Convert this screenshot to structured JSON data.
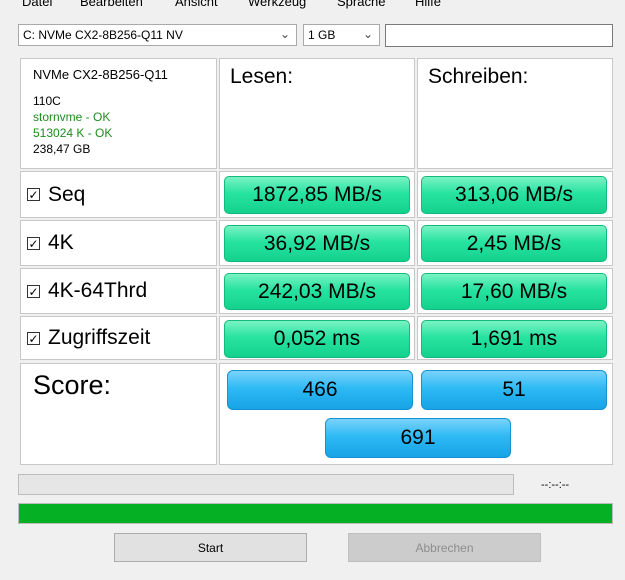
{
  "menu": [
    "Datei",
    "Bearbeiten",
    "Ansicht",
    "Werkzeug",
    "Sprache",
    "Hilfe"
  ],
  "drive_select": {
    "value": "C: NVMe CX2-8B256-Q11 NV"
  },
  "size_select": {
    "value": "1 GB"
  },
  "info": {
    "model": "NVMe CX2-8B256-Q11",
    "firmware": "110C",
    "driver": "stornvme - OK",
    "alignment": "513024 K - OK",
    "capacity": "238,47 GB"
  },
  "columns": {
    "read": "Lesen:",
    "write": "Schreiben:"
  },
  "rows": [
    {
      "label": "Seq",
      "read": "1872,85 MB/s",
      "write": "313,06 MB/s",
      "checked": true
    },
    {
      "label": "4K",
      "read": "36,92 MB/s",
      "write": "2,45 MB/s",
      "checked": true
    },
    {
      "label": "4K-64Thrd",
      "read": "242,03 MB/s",
      "write": "17,60 MB/s",
      "checked": true
    },
    {
      "label": "Zugriffszeit",
      "read": "0,052 ms",
      "write": "1,691 ms",
      "checked": true
    }
  ],
  "score": {
    "label": "Score:",
    "read": "466",
    "write": "51",
    "total": "691"
  },
  "progress": {
    "time": "--:--:--",
    "overall_percent": 100
  },
  "buttons": {
    "start": "Start",
    "abort": "Abbrechen"
  },
  "colors": {
    "result_green": "#27e3a0",
    "score_blue": "#2ebaf4",
    "progress_green": "#06b025"
  }
}
